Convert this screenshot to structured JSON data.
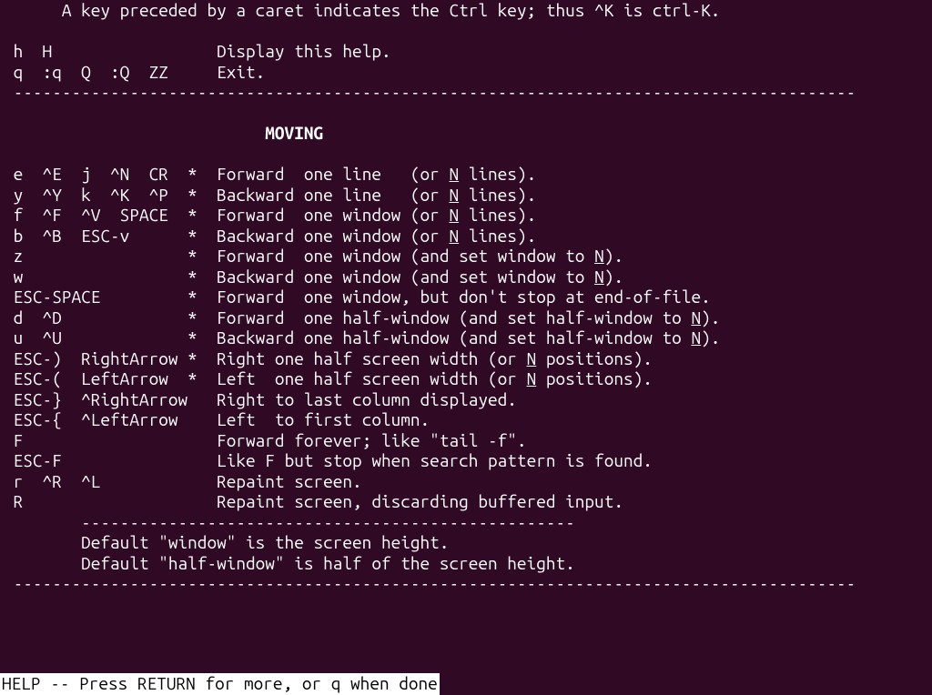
{
  "intro": {
    "caret_line": "      A key preceded by a caret indicates the Ctrl key; thus ^K is ctrl-K.",
    "help_keys": " h  H",
    "help_desc": "Display this help.",
    "quit_keys": " q  :q  Q  :Q  ZZ",
    "quit_desc": "Exit."
  },
  "divider_full": " ---------------------------------------------------------------------------------------",
  "section_header_pad_left": "                           ",
  "section_header": "MOVING",
  "moving": [
    {
      "keys": " e  ^E  j  ^N  CR  *",
      "before": "  Forward  one line   (or ",
      "u": "N",
      "after": " lines)."
    },
    {
      "keys": " y  ^Y  k  ^K  ^P  *",
      "before": "  Backward one line   (or ",
      "u": "N",
      "after": " lines)."
    },
    {
      "keys": " f  ^F  ^V  SPACE  *",
      "before": "  Forward  one window (or ",
      "u": "N",
      "after": " lines)."
    },
    {
      "keys": " b  ^B  ESC-v      *",
      "before": "  Backward one window (or ",
      "u": "N",
      "after": " lines)."
    },
    {
      "keys": " z                 *",
      "before": "  Forward  one window (and set window to ",
      "u": "N",
      "after": ")."
    },
    {
      "keys": " w                 *",
      "before": "  Backward one window (and set window to ",
      "u": "N",
      "after": ")."
    },
    {
      "keys": " ESC-SPACE         *",
      "before": "  Forward  one window, but don't stop at end-of-file.",
      "u": "",
      "after": ""
    },
    {
      "keys": " d  ^D             *",
      "before": "  Forward  one half-window (and set half-window to ",
      "u": "N",
      "after": ")."
    },
    {
      "keys": " u  ^U             *",
      "before": "  Backward one half-window (and set half-window to ",
      "u": "N",
      "after": ")."
    },
    {
      "keys": " ESC-)  RightArrow *",
      "before": "  Right one half screen width (or ",
      "u": "N",
      "after": " positions)."
    },
    {
      "keys": " ESC-(  LeftArrow  *",
      "before": "  Left  one half screen width (or ",
      "u": "N",
      "after": " positions)."
    },
    {
      "keys": " ESC-}  ^RightArrow ",
      "before": "  Right to last column displayed.",
      "u": "",
      "after": ""
    },
    {
      "keys": " ESC-{  ^LeftArrow  ",
      "before": "  Left  to first column.",
      "u": "",
      "after": ""
    },
    {
      "keys": " F                  ",
      "before": "  Forward forever; like \"tail -f\".",
      "u": "",
      "after": ""
    },
    {
      "keys": " ESC-F              ",
      "before": "  Like F but stop when search pattern is found.",
      "u": "",
      "after": ""
    },
    {
      "keys": " r  ^R  ^L          ",
      "before": "  Repaint screen.",
      "u": "",
      "after": ""
    },
    {
      "keys": " R                  ",
      "before": "  Repaint screen, discarding buffered input.",
      "u": "",
      "after": ""
    }
  ],
  "sub_divider": "        ---------------------------------------------------",
  "defaults": {
    "window": "        Default \"window\" is the screen height.",
    "half_window": "        Default \"half-window\" is half of the screen height."
  },
  "statusbar": "HELP -- Press RETURN for more, or q when done"
}
